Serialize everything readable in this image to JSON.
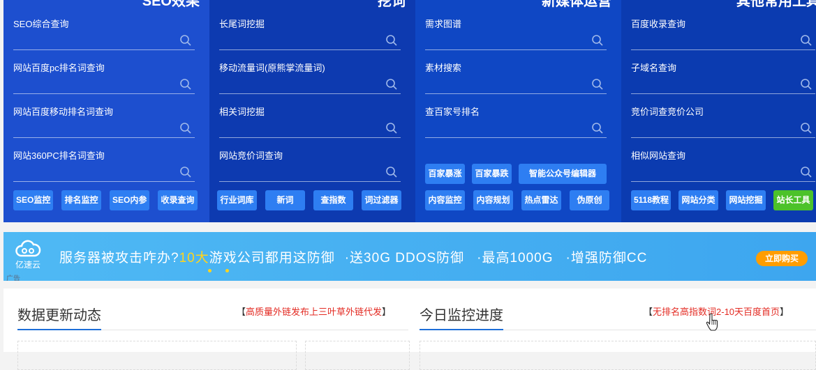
{
  "columns": [
    {
      "title": "SEO效果",
      "fields": [
        "SEO综合查询",
        "网站百度pc排名词查询",
        "网站百度移动排名词查询",
        "网站360PC排名词查询"
      ],
      "buttons": [
        "SEO监控",
        "排名监控",
        "SEO内参",
        "收录查询"
      ]
    },
    {
      "title": "挖词",
      "fields": [
        "长尾词挖掘",
        "移动流量词(原熊掌流量词)",
        "相关词挖掘",
        "网站竞价词查询"
      ],
      "buttons": [
        "行业词库",
        "新词",
        "查指数",
        "词过滤器"
      ]
    },
    {
      "title": "新媒体运营",
      "fields": [
        "需求图谱",
        "素材搜索",
        "查百家号排名"
      ],
      "buttons_top": [
        "百家暴涨",
        "百家暴跌",
        "智能公众号编辑器"
      ],
      "buttons": [
        "内容监控",
        "内容规划",
        "热点雷达",
        "伪原创"
      ]
    },
    {
      "title": "其他常用工具",
      "fields": [
        "百度收录查询",
        "子域名查询",
        "竞价词查竞价公司",
        "相似网站查询"
      ],
      "buttons": [
        "5118教程",
        "网站分类",
        "网站挖掘",
        "站长工具"
      ]
    }
  ],
  "banner": {
    "logo_text": "亿速云",
    "text_a": "服务器被攻击咋办?",
    "text_hl": "10大",
    "text_b": "游戏公司都用这防御",
    "text_c": "·送30G DDOS防御",
    "text_d": "·最高1000G",
    "text_e": "·增强防御CC",
    "cta": "立即购买",
    "ad_tag": "广告"
  },
  "lower": {
    "left_title": "数据更新动态",
    "left_link_open": "【",
    "left_link": "高质量外链发布上三叶草外链代发",
    "left_link_close": "】",
    "right_title": "今日监控进度",
    "right_link_open": "【",
    "right_link": "无排名高指数词2-10天百度首页",
    "right_link_close": "】"
  },
  "colors": {
    "col1": "#1d4fcf",
    "col2": "#0d3ab0",
    "col3": "#0f47c4",
    "col4": "#0b3bb0",
    "button": "#2e7ef2",
    "button_green": "#4cc22a",
    "banner": "#46b0f2",
    "highlight": "#ffd41d",
    "cta": "#ff9d00",
    "link_red": "#e32a22"
  }
}
